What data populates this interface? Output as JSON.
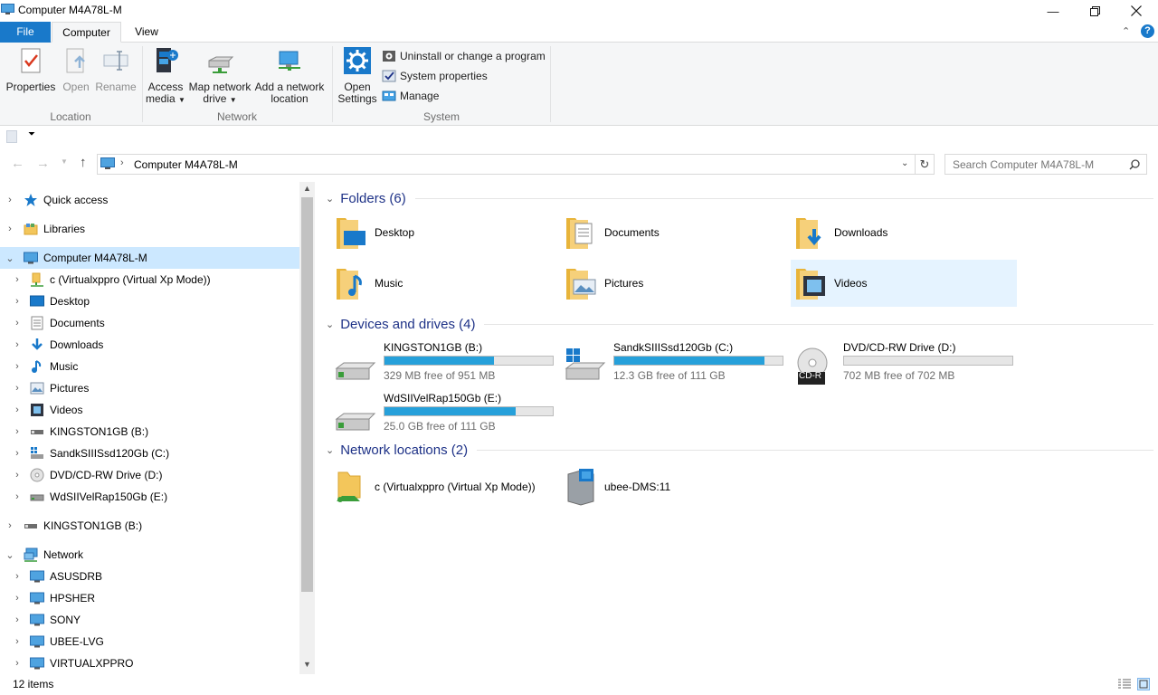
{
  "window": {
    "title": "Computer M4A78L-M"
  },
  "tabs": {
    "file": "File",
    "computer": "Computer",
    "view": "View"
  },
  "ribbon": {
    "location": {
      "label": "Location",
      "properties": "Properties",
      "open": "Open",
      "rename": "Rename"
    },
    "network": {
      "label": "Network",
      "access_media_1": "Access",
      "access_media_2": "media",
      "map_drive_1": "Map network",
      "map_drive_2": "drive",
      "add_location_1": "Add a network",
      "add_location_2": "location"
    },
    "system": {
      "label": "System",
      "open_settings_1": "Open",
      "open_settings_2": "Settings",
      "uninstall": "Uninstall or change a program",
      "sys_props": "System properties",
      "manage": "Manage"
    }
  },
  "address": {
    "path": "Computer M4A78L-M",
    "search_placeholder": "Search Computer M4A78L-M"
  },
  "nav": {
    "quick_access": "Quick access",
    "libraries": "Libraries",
    "computer": "Computer M4A78L-M",
    "children": [
      "c (Virtualxppro (Virtual Xp Mode))",
      "Desktop",
      "Documents",
      "Downloads",
      "Music",
      "Pictures",
      "Videos",
      "KINGSTON1GB (B:)",
      "SandkSIIISsd120Gb (C:)",
      "DVD/CD-RW Drive (D:)",
      "WdSIIVelRap150Gb (E:)"
    ],
    "kingston": "KINGSTON1GB (B:)",
    "network": "Network",
    "network_children": [
      "ASUSDRB",
      "HPSHER",
      "SONY",
      "UBEE-LVG",
      "VIRTUALXPPRO"
    ]
  },
  "sections": {
    "folders": "Folders (6)",
    "devices": "Devices and drives (4)",
    "network": "Network locations (2)"
  },
  "folders": [
    "Desktop",
    "Documents",
    "Downloads",
    "Music",
    "Pictures",
    "Videos"
  ],
  "drives": [
    {
      "name": "KINGSTON1GB (B:)",
      "free": "329 MB free of 951 MB",
      "used_fraction": 0.65
    },
    {
      "name": "SandkSIIISsd120Gb (C:)",
      "free": "12.3 GB free of 111 GB",
      "used_fraction": 0.89
    },
    {
      "name": "DVD/CD-RW Drive (D:)",
      "free": "702 MB free of 702 MB",
      "used_fraction": 0.0,
      "disc_label": "CD-R"
    },
    {
      "name": "WdSIIVelRap150Gb (E:)",
      "free": "25.0 GB free of 111 GB",
      "used_fraction": 0.78
    }
  ],
  "network_locations": [
    "c (Virtualxppro (Virtual Xp Mode))",
    "ubee-DMS:11"
  ],
  "status": {
    "items": "12 items"
  },
  "colors": {
    "accent": "#1979ca",
    "selection": "#cce8ff",
    "bar": "#26a0da",
    "section_text": "#1e3287"
  }
}
